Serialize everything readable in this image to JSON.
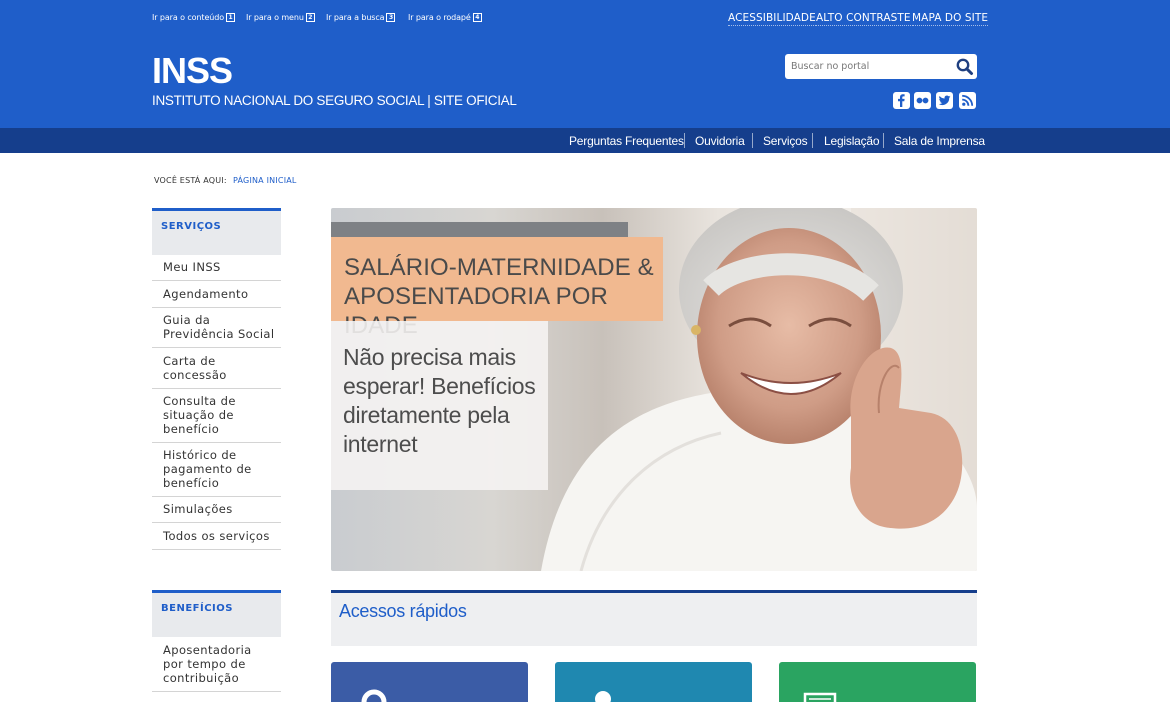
{
  "colors": {
    "header_blue": "#1f5ec9",
    "nav_dark": "#153e8c",
    "tile1": "#3b5ca6",
    "tile2": "#1f88b0",
    "tile3": "#2aa461"
  },
  "skip_links": [
    {
      "label": "Ir para o conteúdo",
      "key": "1"
    },
    {
      "label": "Ir para o menu",
      "key": "2"
    },
    {
      "label": "Ir para a busca",
      "key": "3"
    },
    {
      "label": "Ir para o rodapé",
      "key": "4"
    }
  ],
  "utility_links": [
    "ACESSIBILIDADE",
    "ALTO CONTRASTE",
    "MAPA DO SITE"
  ],
  "brand": {
    "name": "INSS",
    "subtitle": "INSTITUTO NACIONAL DO SEGURO SOCIAL | SITE OFICIAL"
  },
  "search": {
    "placeholder": "Buscar no portal",
    "icon": "search-icon"
  },
  "social_icons": [
    "facebook-icon",
    "flickr-icon",
    "twitter-icon",
    "rss-icon"
  ],
  "nav": [
    "Perguntas Frequentes",
    "Ouvidoria",
    "Serviços",
    "Legislação",
    "Sala de Imprensa"
  ],
  "breadcrumb": {
    "label": "VOCÊ ESTÁ AQUI:",
    "current": "PÁGINA INICIAL"
  },
  "sidebar": {
    "services_title": "SERVIÇOS",
    "services": [
      [
        "Meu INSS"
      ],
      [
        "Agendamento"
      ],
      [
        "Guia da",
        "Previdência Social"
      ],
      [
        "Carta de",
        "concessão"
      ],
      [
        "Consulta de",
        "situação de",
        "benefício"
      ],
      [
        "Histórico de",
        "pagamento de",
        "benefício"
      ],
      [
        "Simulações"
      ],
      [
        "Todos os serviços"
      ]
    ],
    "benefits_title": "BENEFÍCIOS",
    "benefits": [
      [
        "Aposentadoria",
        "por tempo de",
        "contribuição"
      ]
    ]
  },
  "banner": {
    "headline": "SALÁRIO-MATERNIDADE & APOSENTADORIA POR IDADE",
    "tagline": "Não precisa mais esperar! Benefícios diretamente pela internet"
  },
  "quick_access": {
    "title": "Acessos rápidos"
  }
}
